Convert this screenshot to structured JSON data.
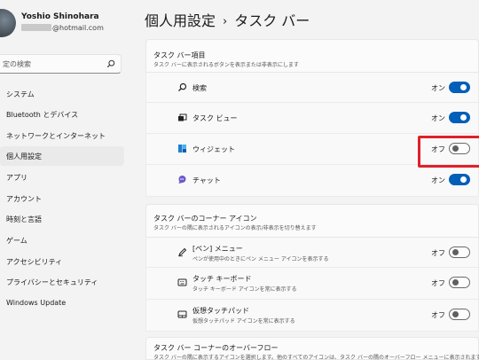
{
  "user": {
    "name": "Yoshio Shinohara",
    "email": "@hotmail.com"
  },
  "search": {
    "placeholder": "定の検索"
  },
  "sidebar": {
    "items": [
      {
        "label": "システム"
      },
      {
        "label": "Bluetooth とデバイス"
      },
      {
        "label": "ネットワークとインターネット"
      },
      {
        "label": "個人用設定",
        "selected": true
      },
      {
        "label": "アプリ"
      },
      {
        "label": "アカウント"
      },
      {
        "label": "時刻と言語"
      },
      {
        "label": "ゲーム"
      },
      {
        "label": "アクセシビリティ"
      },
      {
        "label": "プライバシーとセキュリティ"
      },
      {
        "label": "Windows Update"
      }
    ]
  },
  "header": {
    "breadcrumb_parent": "個人用設定",
    "separator": "›",
    "title": "タスク バー"
  },
  "sections": {
    "taskbar_items": {
      "title": "タスク バー項目",
      "description": "タスク バーに表示されるボタンを表示または非表示にします",
      "rows": [
        {
          "label": "検索",
          "state": "オン",
          "on": true,
          "icon": "search-icon"
        },
        {
          "label": "タスク ビュー",
          "state": "オン",
          "on": true,
          "icon": "task-view-icon"
        },
        {
          "label": "ウィジェット",
          "state": "オフ",
          "on": false,
          "icon": "widgets-icon"
        },
        {
          "label": "チャット",
          "state": "オン",
          "on": true,
          "icon": "chat-icon"
        }
      ]
    },
    "corner_icons": {
      "title": "タスク バーのコーナー アイコン",
      "description": "タスク バーの隅に表示されるアイコンの表示/非表示を切り替えます",
      "rows": [
        {
          "label": "[ペン] メニュー",
          "sub": "ペンが使用中のときにペン メニュー アイコンを表示する",
          "state": "オフ",
          "on": false,
          "icon": "pen-icon"
        },
        {
          "label": "タッチ キーボード",
          "sub": "タッチ キーボード アイコンを常に表示する",
          "state": "オフ",
          "on": false,
          "icon": "keyboard-icon"
        },
        {
          "label": "仮想タッチパッド",
          "sub": "仮想タッチパッド アイコンを常に表示する",
          "state": "オフ",
          "on": false,
          "icon": "touchpad-icon"
        }
      ]
    },
    "overflow": {
      "title": "タスク バー コーナーのオーバーフロー",
      "description": "タスク バーの隅に表示するアイコンを選択します。他のすべてのアイコンは、タスク バーの隅のオーバーフロー メニューに表示されます"
    }
  },
  "colors": {
    "accent": "#005fb8",
    "highlight": "#e0202a",
    "background": "#f3f3f3"
  }
}
